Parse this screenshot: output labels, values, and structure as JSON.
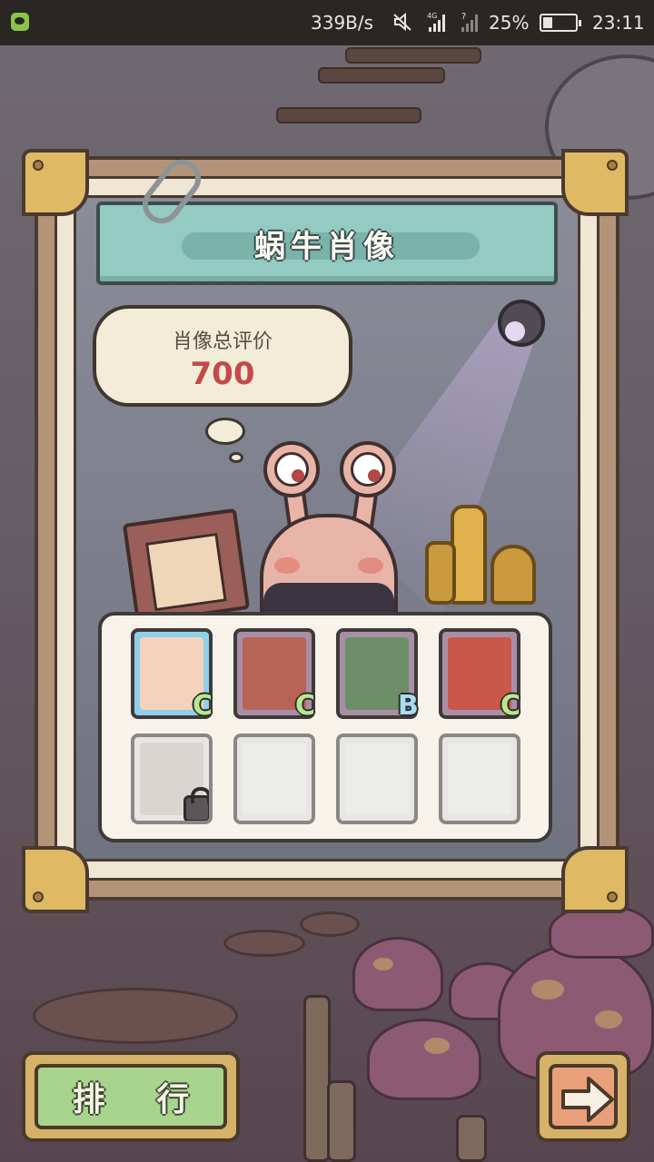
{
  "status_bar": {
    "network_speed": "339B/s",
    "network_type": "4G",
    "battery_percent": "25%",
    "time": "23:11",
    "icons": [
      "wechat-icon",
      "mute-icon",
      "signal-icon",
      "battery-icon"
    ]
  },
  "panel": {
    "title": "蜗牛肖像",
    "rating_label": "肖像总评价",
    "rating_value": "700"
  },
  "portraits": [
    {
      "grade": "C",
      "unlocked": true,
      "selected": true,
      "art_color": "#f4d2bc",
      "grade_color": "#b8e88c"
    },
    {
      "grade": "C",
      "unlocked": true,
      "selected": false,
      "art_color": "#b76457",
      "grade_color": "#b8e88c"
    },
    {
      "grade": "B",
      "unlocked": true,
      "selected": false,
      "art_color": "#6c8f68",
      "grade_color": "#a8dcf0"
    },
    {
      "grade": "C",
      "unlocked": true,
      "selected": false,
      "art_color": "#c9574a",
      "grade_color": "#b8e88c"
    },
    {
      "grade": "",
      "unlocked": false,
      "selected": false,
      "art_color": "#d9d6d2"
    },
    {
      "grade": "",
      "unlocked": false,
      "selected": false,
      "art_color": "#ececea"
    },
    {
      "grade": "",
      "unlocked": false,
      "selected": false,
      "art_color": "#ececea"
    },
    {
      "grade": "",
      "unlocked": false,
      "selected": false,
      "art_color": "#ececea"
    }
  ],
  "buttons": {
    "rank_label": "排 行",
    "next_icon": "arrow-right-icon"
  },
  "colors": {
    "banner": "#93cbc2",
    "rating_value": "#c44a4a",
    "rank_button": "#a8d48e",
    "next_button": "#e9a07a"
  }
}
